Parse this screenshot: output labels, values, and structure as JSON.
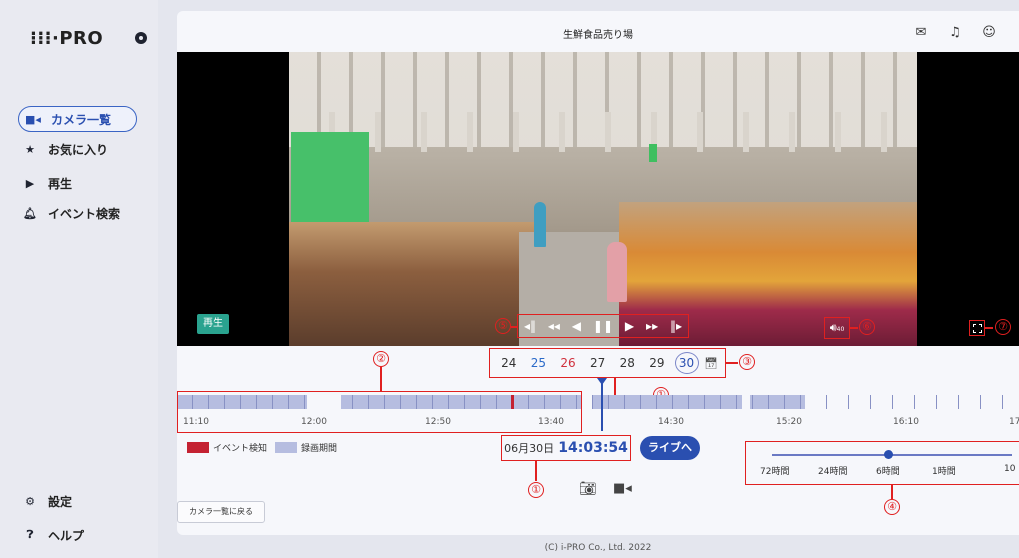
{
  "sidebar": {
    "logo": "⁝⁝⁝·PRO",
    "items": [
      {
        "label": "カメラ一覧",
        "icon": "camera-icon",
        "active": true
      },
      {
        "label": "お気に入り",
        "icon": "star-icon"
      },
      {
        "label": "再生",
        "icon": "play-icon"
      },
      {
        "label": "イベント検索",
        "icon": "bell-icon"
      }
    ],
    "bottom": [
      {
        "label": "設定",
        "icon": "gear-icon"
      },
      {
        "label": "ヘルプ",
        "icon": "help-icon"
      }
    ]
  },
  "header": {
    "title": "生鮮食品売り場"
  },
  "video": {
    "play_badge": "再生",
    "volume_level": "40"
  },
  "callouts": {
    "c1": "①",
    "c2": "②",
    "c3": "③",
    "c4": "④",
    "c5": "⑤",
    "c6": "⑥",
    "c7": "⑦"
  },
  "dates": [
    "24",
    "25",
    "26",
    "27",
    "28",
    "29",
    "30"
  ],
  "timeline": {
    "ticks": [
      "11:10",
      "12:00",
      "12:50",
      "13:40",
      "14:30",
      "15:20",
      "16:10",
      "17"
    ]
  },
  "legend": {
    "event": "イベント検知",
    "recording": "録画期間",
    "event_color": "#c42232",
    "recording_color": "#b6bde0"
  },
  "datetime": {
    "date": "06月30日",
    "time": "14:03:54"
  },
  "live_button": "ライブへ",
  "zoom": {
    "labels": [
      "72時間",
      "24時間",
      "6時間",
      "1時間",
      "10"
    ]
  },
  "back_button": "カメラ一覧に戻る",
  "footer": "(C) i-PRO Co., Ltd. 2022"
}
